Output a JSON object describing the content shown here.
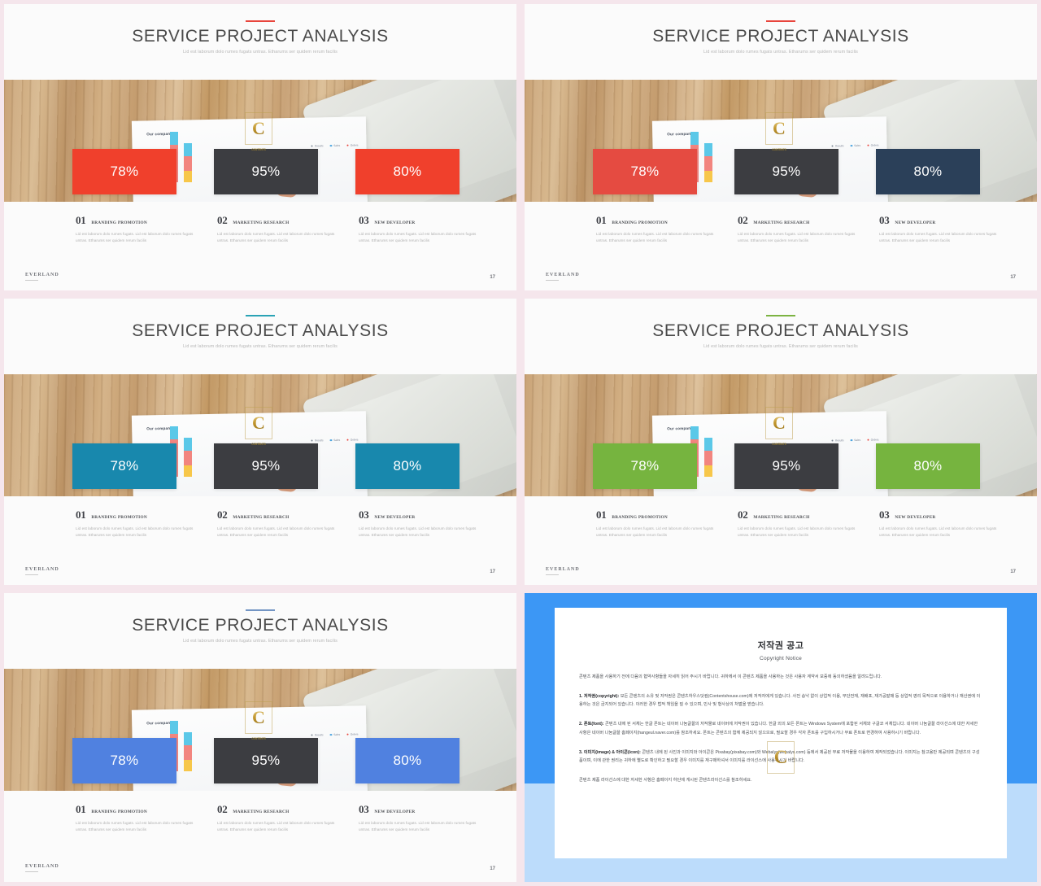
{
  "deck": {
    "title": "SERVICE PROJECT ANALYSIS",
    "subtitle": "Lid est laborum dolo rumes fugats untras. Etharums ser quidem rerum facilis",
    "brand": "EVERLAND",
    "page_number": "17",
    "photo": {
      "paper_label": "Our company",
      "legend": [
        {
          "label": "Results",
          "color": "#7d8794"
        },
        {
          "label": "Sales",
          "color": "#4aa3df"
        },
        {
          "label": "Orders",
          "color": "#e8453c"
        }
      ],
      "bars": [
        {
          "segments": [
            {
              "color": "#f2857f",
              "height": 46
            },
            {
              "color": "#5bc8e8",
              "height": 16
            }
          ]
        },
        {
          "segments": [
            {
              "color": "#f7c74a",
              "height": 14
            },
            {
              "color": "#f2857f",
              "height": 18
            },
            {
              "color": "#5bc8e8",
              "height": 16
            }
          ]
        }
      ],
      "watermark_letter": "C",
      "watermark_caption": "CONTENTS"
    },
    "stats": [
      {
        "value": "78%"
      },
      {
        "value": "95%"
      },
      {
        "value": "80%"
      }
    ],
    "columns": [
      {
        "number": "01",
        "title": "BRANDING PROMOTION",
        "body": "Lid est laborum dolo rumes fugats. Lid est laborum dolo rumes fugats untras. Etharums ser quidem rerum facilis"
      },
      {
        "number": "02",
        "title": "MARKETING RESEARCH",
        "body": "Lid est laborum dolo rumes fugats. Lid est laborum dolo rumes fugats untras. Etharums ser quidem rerum facilis"
      },
      {
        "number": "03",
        "title": "NEW DEVELOPER",
        "body": "Lid est laborum dolo rumes fugats. Lid est laborum dolo rumes fugats untras. Etharums ser quidem rerum facilis"
      }
    ]
  },
  "slides": [
    {
      "id": "slide-red",
      "accent_color": "#e8453c",
      "stat_colors": [
        "#f0402c",
        "#3c3d41",
        "#f0402c"
      ]
    },
    {
      "id": "slide-amber",
      "accent_color": "#e8453c",
      "stat_colors": [
        "#e54b41",
        "#eda320",
        "#2b4059"
      ]
    },
    {
      "id": "slide-teal",
      "accent_color": "#2aa3b5",
      "stat_colors": [
        "#1888ad",
        "#3c3d41",
        "#1888ad"
      ]
    },
    {
      "id": "slide-green",
      "accent_color": "#7cb342",
      "stat_colors": [
        "#76b43f",
        "#3c3d41",
        "#76b43f"
      ]
    },
    {
      "id": "slide-blue",
      "accent_color": "#7395c4",
      "stat_colors": [
        "#5081e0",
        "#3c3d41",
        "#5081e0"
      ]
    }
  ],
  "copyright": {
    "border_color": "#3c97f5",
    "band_color": "#bcdcfb",
    "title": "저작권 공고",
    "subtitle": "Copyright Notice",
    "intro": "콘텐츠 제품을 사용하기 전에 다음의 협약사항들을 자세히 읽어 주시기 바랍니다. 귀하께서 이 콘텐츠 제품을 사용하는 것은 사용자 계약서 보증에 동의하셨음을 알려드립니다.",
    "sections": [
      {
        "heading": "1. 저작권(copyright):",
        "text": " 모든 콘텐츠의 소유 및 저작권은 콘텐츠하우스닷컴(Contentshouse.com)에 저작자에게 있습니다. 사전 승낙 없이 상업적 이용, 무단전재, 재배포, 재가공발매 등 상업적 영리 목적으로 이용하거나 재산권에 이용하는 것은 금지되어 있습니다. 이러한 경우 법적 책임을 질 수 있으며, 민사 및 형사상의 처벌을 받습니다."
      },
      {
        "heading": "2. 폰트(font):",
        "text": " 콘텐츠 내에 된 서체는 한글 폰트는 네이버 나눔글꼴의 저작물로 네이버에 저작권이 있습니다. 한글 외의 모든 폰트는 Windows System에 포함된 서체와 구글코 서체입니다. 네이버 나눔글꼴 라이선스에 대한 자세한 사항은 네이버 나눔글꼴 홈페이지(hangeul.naver.com)를 참조하세요. 폰트는 콘텐츠의 함께 제공되지 않으므로, 필요할 경우 각자 폰트를 구입하시거나 무료 폰트로 변경하여 사용하시기 바랍니다."
      },
      {
        "heading": "3. 이미지(image) & 아이콘(icon):",
        "text": " 콘텐츠 내에 된 사진과 이미지와 아이콘은 Pixabay(pixabay.com)와 Webalys(webalys.com) 등에서 제공된 무료 저작물을 이용하여 제작되었습니다. 이미지는 참고용만 제공되며 콘텐츠의 구성품이며, 이에 관한 권리는 귀하에 별도로 확인하고 필요할 경우 이미지를 재구매하셔서 이미지를 라이선스에 사용하시기 바랍니다."
      }
    ],
    "outro": "콘텐츠 제품 라이선스에 대한 자세한 사항은 홈페이지 하단에 게시된 콘텐츠라이선스를 참조하세요.",
    "watermark_letter": "C"
  }
}
